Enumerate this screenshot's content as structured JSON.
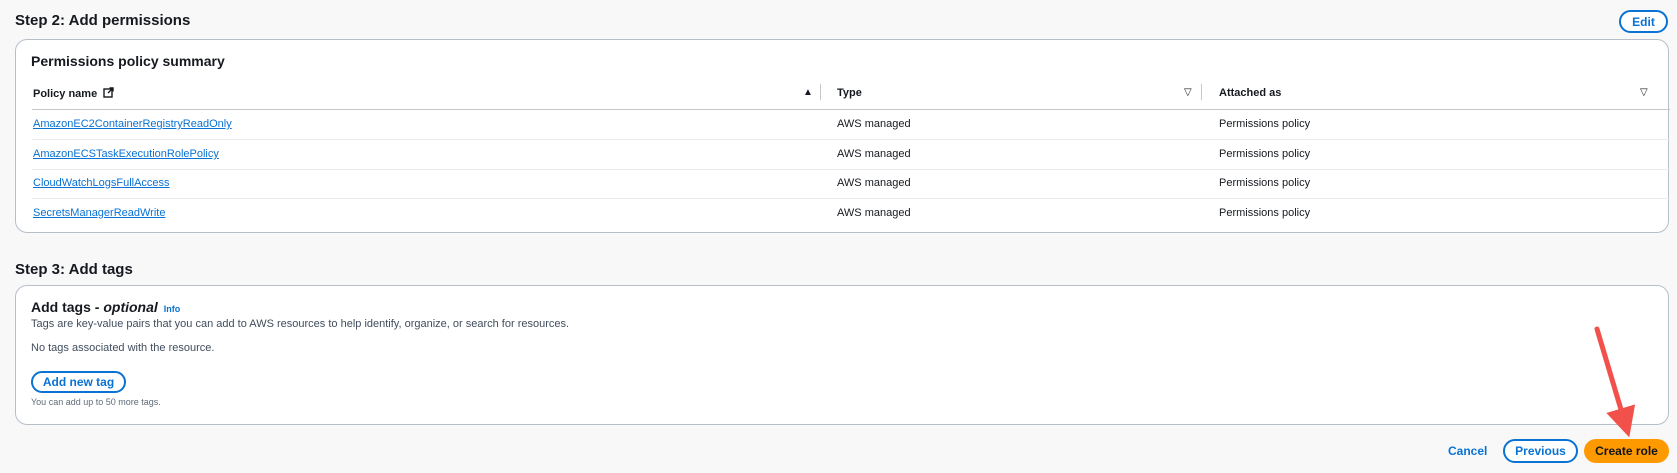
{
  "step2": {
    "title": "Step 2: Add permissions",
    "edit_label": "Edit",
    "container_title": "Permissions policy summary",
    "columns": [
      "Policy name",
      "Type",
      "Attached as"
    ],
    "rows": [
      {
        "policy": "AmazonEC2ContainerRegistryReadOnly",
        "type": "AWS managed",
        "attached": "Permissions policy"
      },
      {
        "policy": "AmazonECSTaskExecutionRolePolicy",
        "type": "AWS managed",
        "attached": "Permissions policy"
      },
      {
        "policy": "CloudWatchLogsFullAccess",
        "type": "AWS managed",
        "attached": "Permissions policy"
      },
      {
        "policy": "SecretsManagerReadWrite",
        "type": "AWS managed",
        "attached": "Permissions policy"
      }
    ],
    "icons": {
      "external": "external-link-icon",
      "sort_asc": "sort-ascending-icon",
      "sort": "sort-icon"
    }
  },
  "step3": {
    "title": "Step 3: Add tags",
    "container_title": "Add tags - ",
    "optional": "optional",
    "info": "Info",
    "description": "Tags are key-value pairs that you can add to AWS resources to help identify, organize, or search for resources.",
    "empty": "No tags associated with the resource.",
    "add_tag_label": "Add new tag",
    "hint": "You can add up to 50 more tags."
  },
  "footer": {
    "cancel_label": "Cancel",
    "previous_label": "Previous",
    "create_label": "Create role"
  },
  "colors": {
    "accent": "#0972d3",
    "primary": "#ff9900",
    "annotation_arrow": "#f2514b"
  }
}
